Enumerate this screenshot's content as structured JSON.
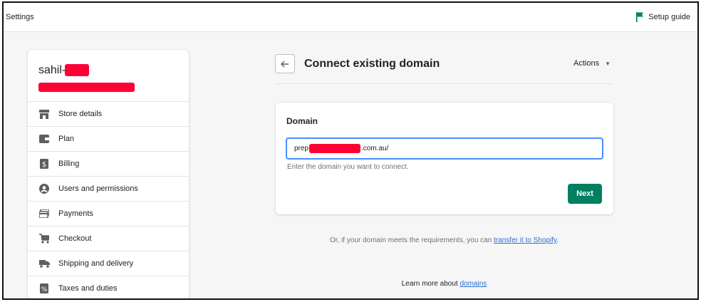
{
  "topbar": {
    "title": "Settings",
    "setup_guide_label": "Setup guide",
    "setup_guide_icon": "flag-icon"
  },
  "sidebar": {
    "store_name": "sahil-",
    "items": [
      {
        "label": "Store details",
        "icon": "store-icon"
      },
      {
        "label": "Plan",
        "icon": "plan-icon"
      },
      {
        "label": "Billing",
        "icon": "billing-icon"
      },
      {
        "label": "Users and permissions",
        "icon": "user-icon"
      },
      {
        "label": "Payments",
        "icon": "payments-icon"
      },
      {
        "label": "Checkout",
        "icon": "cart-icon"
      },
      {
        "label": "Shipping and delivery",
        "icon": "truck-icon"
      },
      {
        "label": "Taxes and duties",
        "icon": "tax-icon"
      }
    ]
  },
  "main": {
    "title": "Connect existing domain",
    "actions_label": "Actions",
    "card": {
      "title": "Domain",
      "input_prefix": "prep",
      "input_suffix": ".com.au/",
      "help_text": "Enter the domain you want to connect.",
      "next_label": "Next"
    },
    "transfer_text": "Or, if your domain meets the requirements, you can ",
    "transfer_link": "transfer it to Shopify",
    "transfer_end": ".",
    "learn_text": "Learn more about ",
    "learn_link": "domains"
  },
  "colors": {
    "primary_button": "#008060",
    "focus_border": "#458fff",
    "link": "#2c6ecb",
    "redaction": "#ff0033",
    "flag": "#008060"
  }
}
